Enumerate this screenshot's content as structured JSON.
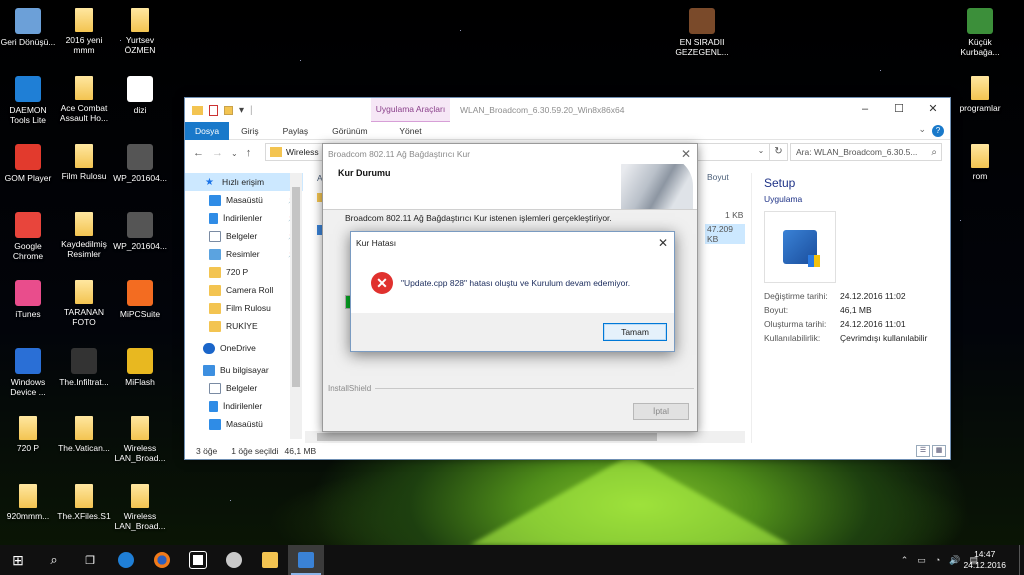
{
  "desktop": {
    "icons": [
      {
        "label": "Geri Dönüşü...",
        "icon": "recycle-bin-icon",
        "color": "#6ca0d8"
      },
      {
        "label": "2016 yeni mmm",
        "icon": "folder-icon",
        "color": "#f3c451"
      },
      {
        "label": "Yurtsev ÖZMEN",
        "icon": "folder-icon",
        "color": "#f3c451"
      },
      {
        "label": "EN SIRADII GEZEGENL...",
        "icon": "image-file-icon",
        "color": "#7a4a2a"
      },
      {
        "label": "Küçük Kurbağa...",
        "icon": "image-file-icon",
        "color": "#3c8f3a"
      },
      {
        "label": "DAEMON Tools Lite",
        "icon": "daemon-tools-icon",
        "color": "#1f7fd6"
      },
      {
        "label": "Ace Combat Assault Ho...",
        "icon": "folder-icon",
        "color": "#f3c451"
      },
      {
        "label": "dizi",
        "icon": "document-icon",
        "color": "#ffffff"
      },
      {
        "label": "programlar",
        "icon": "folder-icon",
        "color": "#f3c451"
      },
      {
        "label": "GOM Player",
        "icon": "gom-player-icon",
        "color": "#e23a2d"
      },
      {
        "label": "Film Rulosu",
        "icon": "folder-icon",
        "color": "#f3c451"
      },
      {
        "label": "WP_201604...",
        "icon": "video-file-icon",
        "color": "#555555"
      },
      {
        "label": "rom",
        "icon": "folder-icon",
        "color": "#f3c451"
      },
      {
        "label": "Google Chrome",
        "icon": "chrome-icon",
        "color": "#e8453c"
      },
      {
        "label": "Kaydedilmiş Resimler",
        "icon": "folder-icon",
        "color": "#f3c451"
      },
      {
        "label": "WP_201604...",
        "icon": "video-file-icon",
        "color": "#555555"
      },
      {
        "label": "iTunes",
        "icon": "itunes-icon",
        "color": "#e94d8c"
      },
      {
        "label": "TARANAN FOTO",
        "icon": "folder-icon",
        "color": "#f3c451"
      },
      {
        "label": "MiPCSuite",
        "icon": "mi-icon",
        "color": "#f36c21"
      },
      {
        "label": "Windows Device ...",
        "icon": "windows-device-icon",
        "color": "#2a6fd6"
      },
      {
        "label": "The.Infiltrat...",
        "icon": "video-file-icon",
        "color": "#333333"
      },
      {
        "label": "MiFlash",
        "icon": "miflash-icon",
        "color": "#e8b820"
      },
      {
        "label": "720 P",
        "icon": "folder-icon",
        "color": "#f3c451"
      },
      {
        "label": "The.Vatican...",
        "icon": "folder-icon",
        "color": "#f3c451"
      },
      {
        "label": "Wireless LAN_Broad...",
        "icon": "folder-icon",
        "color": "#f3c451"
      },
      {
        "label": "920mmm...",
        "icon": "folder-icon",
        "color": "#f3c451"
      },
      {
        "label": "The.XFiles.S1",
        "icon": "folder-icon",
        "color": "#f3c451"
      },
      {
        "label": "Wireless LAN_Broad...",
        "icon": "folder-icon",
        "color": "#f3c451"
      }
    ]
  },
  "explorer": {
    "context_tab": "Uygulama Araçları",
    "title": "WLAN_Broadcom_6.30.59.20_Win8x86x64",
    "ribbon_tabs": {
      "file": "Dosya",
      "home": "Giriş",
      "share": "Paylaş",
      "view": "Görünüm",
      "manage": "Yönet"
    },
    "address": "Wireless",
    "search_placeholder": "Ara: WLAN_Broadcom_6.30.5...",
    "nav": {
      "quick_access": "Hızlı erişim",
      "items": [
        "Masaüstü",
        "İndirilenler",
        "Belgeler",
        "Resimler",
        "720 P",
        "Camera Roll",
        "Film Rulosu",
        "RUKİYE"
      ],
      "onedrive": "OneDrive",
      "this_pc": "Bu bilgisayar",
      "pc_items": [
        "Belgeler",
        "İndirilenler",
        "Masaüstü"
      ]
    },
    "columns": {
      "name_partial": "Ad",
      "size": "Boyut"
    },
    "files": {
      "size1": "1 KB",
      "size2": "47.209 KB"
    },
    "details": {
      "name": "Setup",
      "type": "Uygulama",
      "modified_label": "Değiştirme tarihi:",
      "modified": "24.12.2016 11:02",
      "size_label": "Boyut:",
      "size": "46,1 MB",
      "created_label": "Oluşturma tarihi:",
      "created": "24.12.2016 11:01",
      "availability_label": "Kullanılabilirlik:",
      "availability": "Çevrimdışı kullanılabilir"
    },
    "status": {
      "count": "3 öğe",
      "selected": "1 öğe seçildi",
      "size": "46,1 MB"
    }
  },
  "setup_dialog": {
    "title": "Broadcom 802.11 Ağ Bağdaştırıcı Kur",
    "heading": "Kur Durumu",
    "message": "Broadcom 802.11 Ağ Bağdaştırıcı Kur istenen işlemleri gerçekleştiriyor.",
    "progress": 0.03,
    "brand": "InstallShield",
    "cancel": "İptal"
  },
  "error_dialog": {
    "title": "Kur Hatası",
    "message": "\"Update.cpp 828\" hatası oluştu ve Kurulum devam edemiyor.",
    "ok": "Tamam"
  },
  "taskbar": {
    "time": "14:47",
    "date": "24.12.2016"
  }
}
